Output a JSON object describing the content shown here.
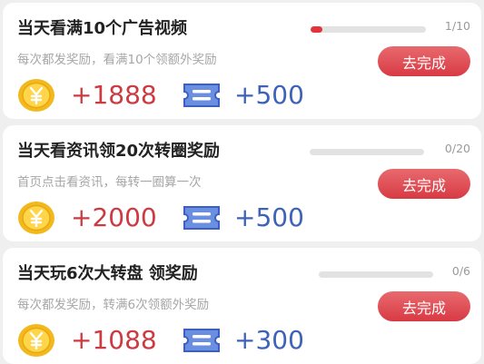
{
  "tasks": [
    {
      "title": "当天看满10个广告视频",
      "subtitle": "每次都发奖励，看满10个领额外奖励",
      "progress_text": "1/10",
      "progress_fraction": 0.1,
      "button_label": "去完成",
      "coin_reward": "+1888",
      "ticket_reward": "+500"
    },
    {
      "title": "当天看资讯领20次转圈奖励",
      "subtitle": "首页点击看资讯，每转一圈算一次",
      "progress_text": "0/20",
      "progress_fraction": 0,
      "button_label": "去完成",
      "coin_reward": "+2000",
      "ticket_reward": "+500"
    },
    {
      "title": "当天玩6次大转盘 领奖励",
      "subtitle": "每次都发奖励，转满6次领额外奖励",
      "progress_text": "0/6",
      "progress_fraction": 0,
      "button_label": "去完成",
      "coin_reward": "+1088",
      "ticket_reward": "+300"
    }
  ],
  "icons": {
    "coin": "gold-yuan-coin-icon",
    "ticket": "blue-ticket-icon"
  },
  "colors": {
    "button": "#e04a50",
    "progress_fill": "#e3343c",
    "coin_value": "#cc3a42",
    "ticket_value": "#3d63b8",
    "background": "#efefef"
  }
}
